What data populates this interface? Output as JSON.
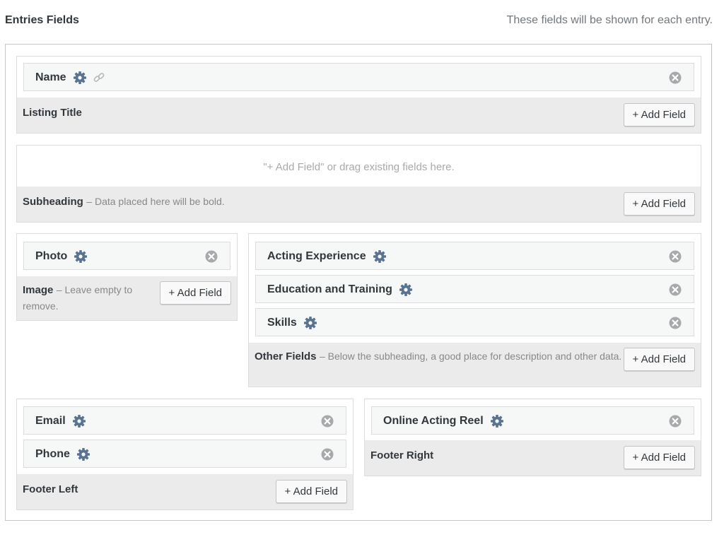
{
  "header": {
    "title": "Entries Fields",
    "description": "These fields will be shown for each entry."
  },
  "listing_title": {
    "fields": [
      {
        "label": "Name",
        "icons": [
          "gear-icon",
          "link-icon"
        ]
      }
    ],
    "footer_title": "Listing Title",
    "add_label": "+ Add Field"
  },
  "subheading": {
    "placeholder": "\"+ Add Field\" or drag existing fields here.",
    "footer_title": "Subheading",
    "footer_desc": "– Data placed here will be bold.",
    "add_label": "+ Add Field"
  },
  "image": {
    "fields": [
      {
        "label": "Photo"
      }
    ],
    "footer_title": "Image",
    "footer_desc": "– Leave empty to remove.",
    "add_label": "+ Add Field"
  },
  "other_fields": {
    "fields": [
      {
        "label": "Acting Experience"
      },
      {
        "label": "Education and Training"
      },
      {
        "label": "Skills"
      }
    ],
    "footer_title": "Other Fields",
    "footer_desc": "– Below the subheading, a good place for description and other data.",
    "add_label": "+ Add Field"
  },
  "footer_left": {
    "fields": [
      {
        "label": "Email"
      },
      {
        "label": "Phone"
      }
    ],
    "footer_title": "Footer Left",
    "add_label": "+ Add Field"
  },
  "footer_right": {
    "fields": [
      {
        "label": "Online Acting Reel"
      }
    ],
    "footer_title": "Footer Right",
    "add_label": "+ Add Field"
  },
  "colors": {
    "gear": "#5a7390",
    "remove": "#a7aaad",
    "footer_bg": "#ebebeb"
  }
}
